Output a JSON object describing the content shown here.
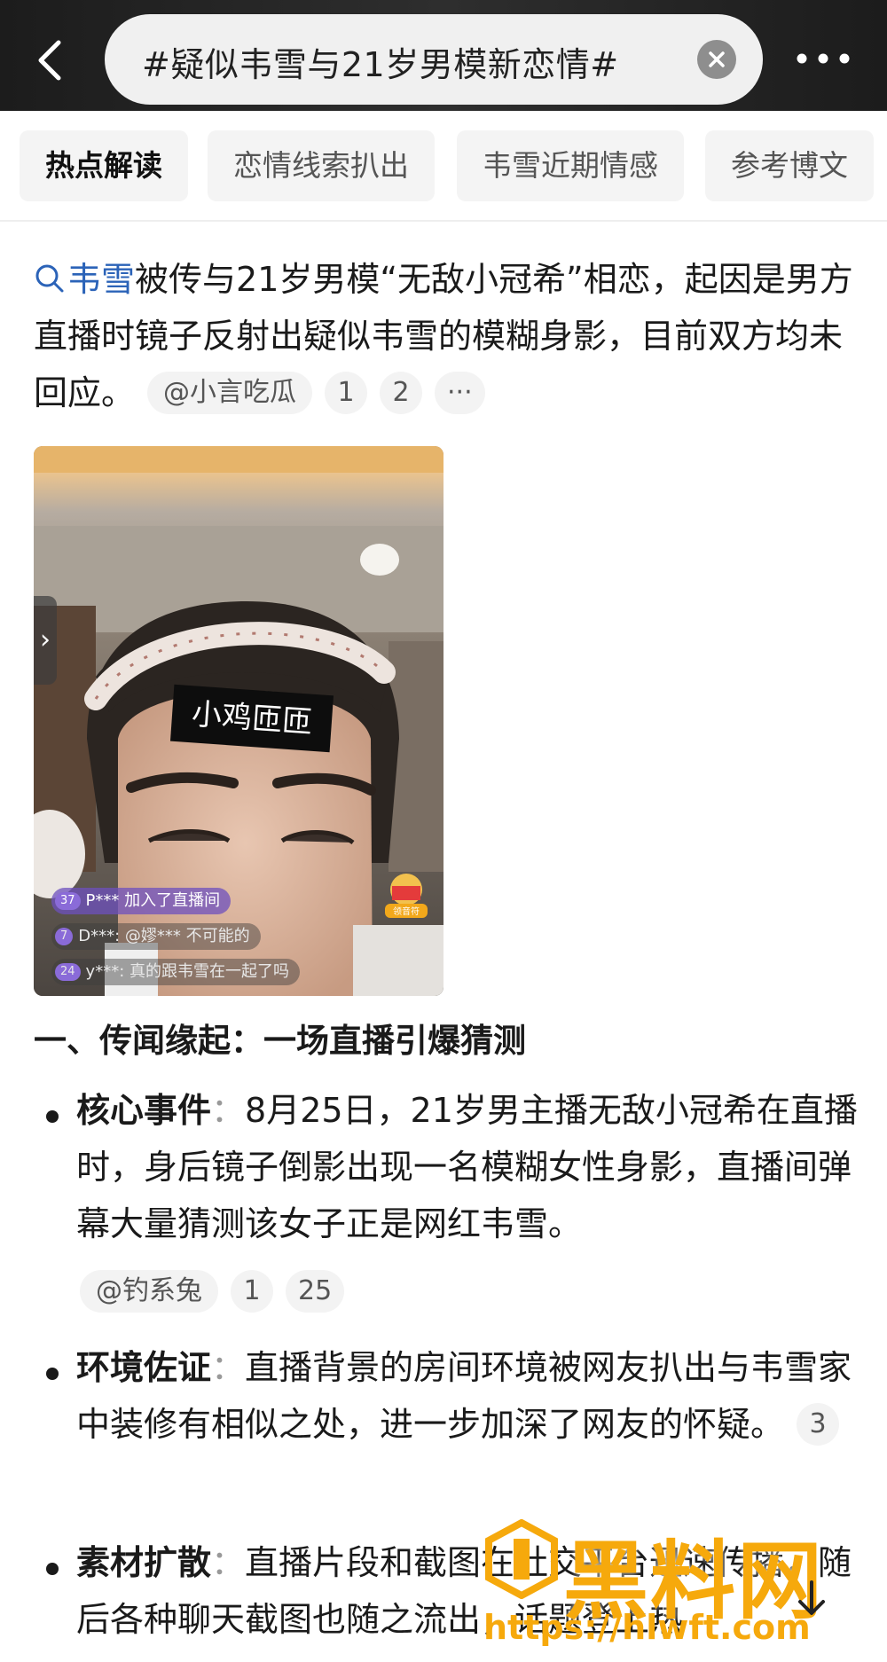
{
  "header": {
    "search_query": "#疑似韦雪与21岁男模新恋情#"
  },
  "tabs": [
    {
      "label": "热点解读",
      "active": true
    },
    {
      "label": "恋情线索扒出",
      "active": false
    },
    {
      "label": "韦雪近期情感",
      "active": false
    },
    {
      "label": "参考博文",
      "active": false
    }
  ],
  "summary": {
    "keyword": "韦雪",
    "text": "被传与21岁男模“无敌小冠希”相恋，起因是男方直播时镜子反射出疑似韦雪的模糊身影，目前双方均未回应。",
    "source": "@小言吃瓜",
    "refs": [
      "1",
      "2"
    ],
    "more": "···"
  },
  "photo": {
    "sticker_text": "小鸡匝匝",
    "chat": [
      {
        "level": "37",
        "text": "P*** 加入了直播间"
      },
      {
        "level": "7",
        "text": "D***: @嫪*** 不可能的"
      },
      {
        "level": "24",
        "text": "y***: 真的跟韦雪在一起了吗"
      }
    ],
    "gift_label": "领音符"
  },
  "section": {
    "heading": "一、传闻缘起：一场直播引爆猜测",
    "items": [
      {
        "title": "核心事件",
        "text": "8月25日，21岁男主播无敌小冠希在直播时，身后镜子倒影出现一名模糊女性身影，直播间弹幕大量猜测该女子正是网红韦雪。",
        "source": "@钓系兔",
        "refs": [
          "1",
          "25"
        ]
      },
      {
        "title": "环境佐证",
        "text": "直播背景的房间环境被网友扒出与韦雪家中装修有相似之处，进一步加深了网友的怀疑。",
        "refs": [
          "3"
        ]
      },
      {
        "title": "素材扩散",
        "text": "直播片段和截图在社交平台迅速传播，随后各种聊天截图也随之流出，话题登上热"
      }
    ]
  },
  "watermark": {
    "brand": "黑料网",
    "url": "https://hlwft.com"
  }
}
